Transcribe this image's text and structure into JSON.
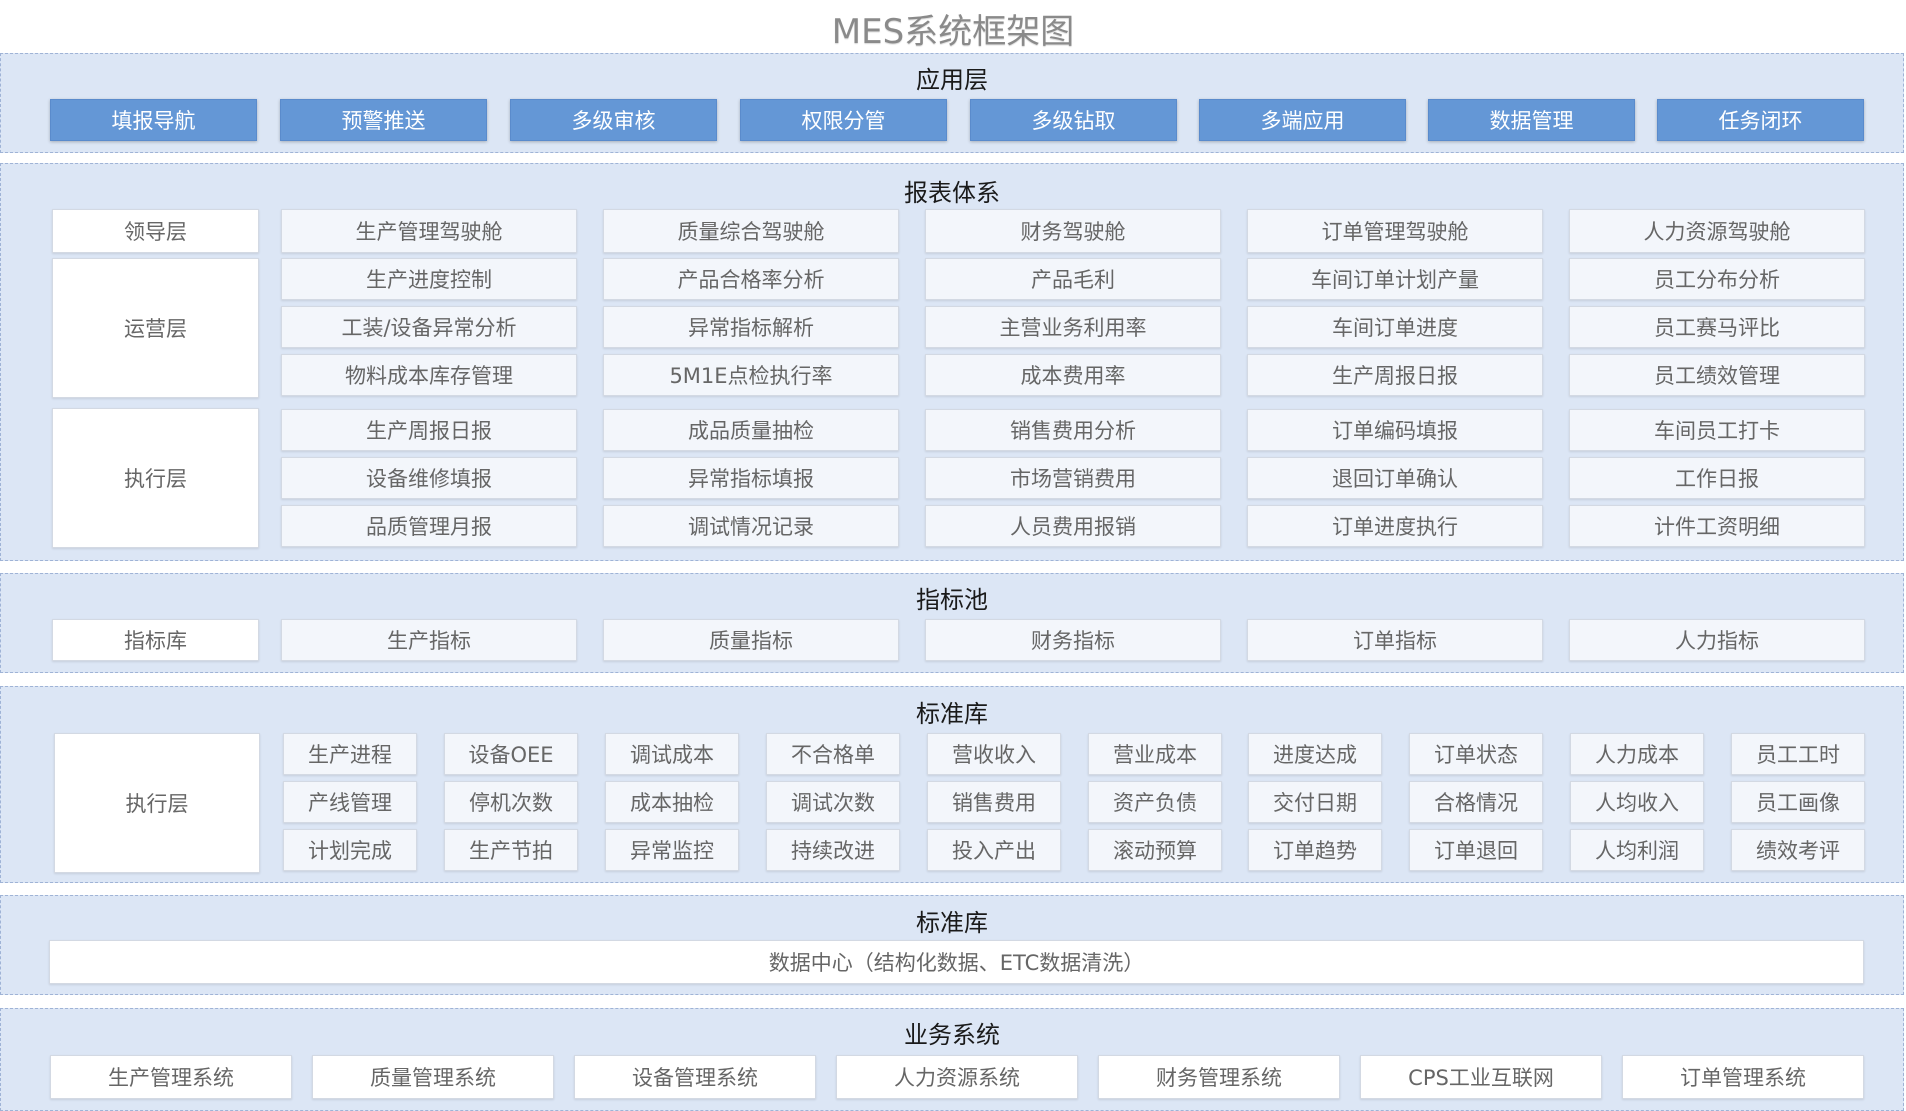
{
  "title": "MES系统框架图",
  "app_layer": {
    "title": "应用层",
    "items": [
      "填报导航",
      "预警推送",
      "多级审核",
      "权限分管",
      "多级钻取",
      "多端应用",
      "数据管理",
      "任务闭环"
    ]
  },
  "report_system": {
    "title": "报表体系",
    "leader_label": "领导层",
    "ops_label": "运营层",
    "exec_label": "执行层",
    "leader_row": [
      "生产管理驾驶舱",
      "质量综合驾驶舱",
      "财务驾驶舱",
      "订单管理驾驶舱",
      "人力资源驾驶舱"
    ],
    "ops_rows": [
      [
        "生产进度控制",
        "产品合格率分析",
        "产品毛利",
        "车间订单计划产量",
        "员工分布分析"
      ],
      [
        "工装/设备异常分析",
        "异常指标解析",
        "主营业务利用率",
        "车间订单进度",
        "员工赛马评比"
      ],
      [
        "物料成本库存管理",
        "5M1E点检执行率",
        "成本费用率",
        "生产周报日报",
        "员工绩效管理"
      ]
    ],
    "exec_rows": [
      [
        "生产周报日报",
        "成品质量抽检",
        "销售费用分析",
        "订单编码填报",
        "车间员工打卡"
      ],
      [
        "设备维修填报",
        "异常指标填报",
        "市场营销费用",
        "退回订单确认",
        "工作日报"
      ],
      [
        "品质管理月报",
        "调试情况记录",
        "人员费用报销",
        "订单进度执行",
        "计件工资明细"
      ]
    ]
  },
  "indicator_pool": {
    "title": "指标池",
    "label": "指标库",
    "items": [
      "生产指标",
      "质量指标",
      "财务指标",
      "订单指标",
      "人力指标"
    ]
  },
  "standard_lib": {
    "title": "标准库",
    "label": "执行层",
    "rows": [
      [
        "生产进程",
        "设备OEE",
        "调试成本",
        "不合格单",
        "营收收入",
        "营业成本",
        "进度达成",
        "订单状态",
        "人力成本",
        "员工工时"
      ],
      [
        "产线管理",
        "停机次数",
        "成本抽检",
        "调试次数",
        "销售费用",
        "资产负债",
        "交付日期",
        "合格情况",
        "人均收入",
        "员工画像"
      ],
      [
        "计划完成",
        "生产节拍",
        "异常监控",
        "持续改进",
        "投入产出",
        "滚动预算",
        "订单趋势",
        "订单退回",
        "人均利润",
        "绩效考评"
      ]
    ]
  },
  "data_center": {
    "title": "标准库",
    "item": "数据中心（结构化数据、ETC数据清洗）"
  },
  "business_systems": {
    "title": "业务系统",
    "items": [
      "生产管理系统",
      "质量管理系统",
      "设备管理系统",
      "人力资源系统",
      "财务管理系统",
      "CPS工业互联网",
      "订单管理系统"
    ]
  }
}
